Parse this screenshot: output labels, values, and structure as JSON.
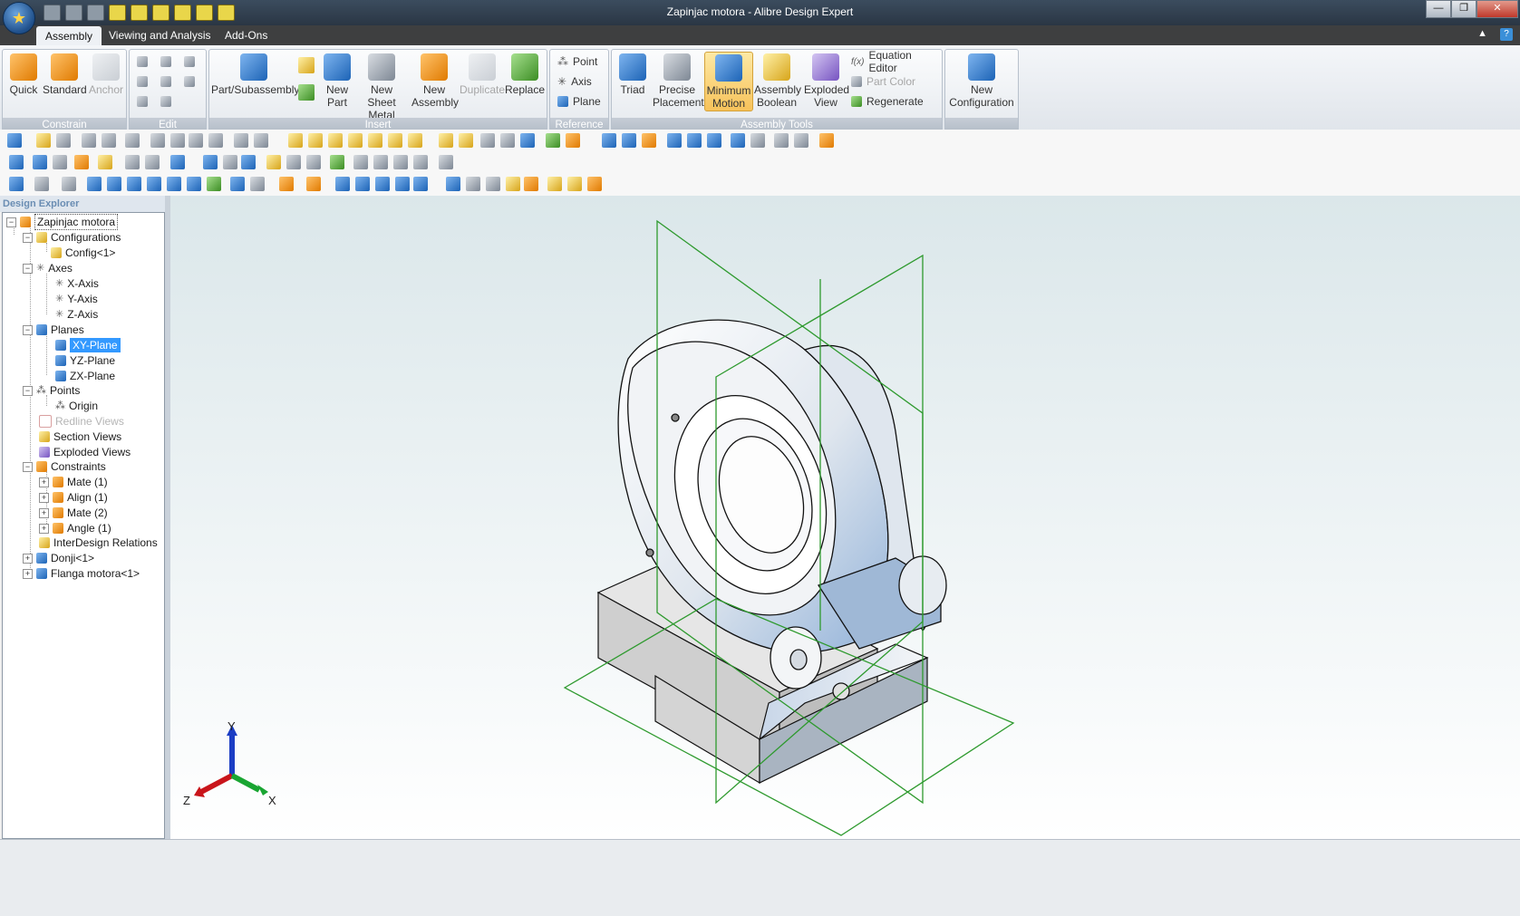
{
  "window": {
    "title": "Zapinjac motora - Alibre Design Expert"
  },
  "tabs": [
    "Assembly",
    "Viewing and Analysis",
    "Add-Ons"
  ],
  "ribbon": {
    "constrain": {
      "label": "Constrain",
      "quick": "Quick",
      "standard": "Standard",
      "anchor": "Anchor"
    },
    "edit": {
      "label": "Edit"
    },
    "insert": {
      "label": "Insert",
      "part_subassembly": "Part/Subassembly",
      "new_part": "New Part",
      "new_sheet_metal": "New Sheet Metal",
      "new_assembly": "New Assembly",
      "duplicate": "Duplicate",
      "replace": "Replace"
    },
    "reference": {
      "label": "Reference",
      "point": "Point",
      "axis": "Axis",
      "plane": "Plane"
    },
    "assembly_tools": {
      "label": "Assembly Tools",
      "triad": "Triad",
      "precise_placement": "Precise Placement",
      "minimum_motion": "Minimum Motion",
      "assembly_boolean": "Assembly Boolean",
      "exploded_view": "Exploded View",
      "equation_editor": "Equation Editor",
      "part_color": "Part Color",
      "regenerate": "Regenerate"
    },
    "config": {
      "new_configuration": "New Configuration"
    }
  },
  "explorer": {
    "header": "Design Explorer",
    "items": {
      "root": "Zapinjac motora",
      "configurations": "Configurations",
      "config1": "Config<1>",
      "axes": "Axes",
      "x_axis": "X-Axis",
      "y_axis": "Y-Axis",
      "z_axis": "Z-Axis",
      "planes": "Planes",
      "xy_plane": "XY-Plane",
      "yz_plane": "YZ-Plane",
      "zx_plane": "ZX-Plane",
      "points": "Points",
      "origin": "Origin",
      "redline_views": "Redline Views",
      "section_views": "Section Views",
      "exploded_views": "Exploded Views",
      "constraints": "Constraints",
      "mate1": "Mate (1)",
      "align1": "Align (1)",
      "mate2": "Mate (2)",
      "angle1": "Angle (1)",
      "interdesign": "InterDesign Relations",
      "donji": "Donji<1>",
      "flanga": "Flanga motora<1>"
    }
  },
  "triad": {
    "x": "X",
    "y": "Y",
    "z": "Z"
  },
  "colors": {
    "plane_green": "#2e9a2e",
    "selection": "#3399ff",
    "viewport_top": "#dbe7ea"
  }
}
